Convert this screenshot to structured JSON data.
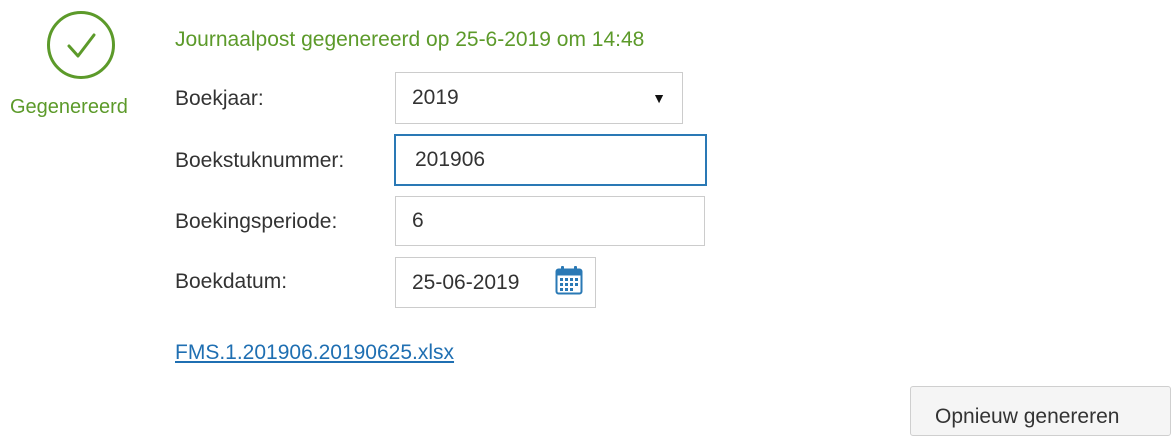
{
  "status": {
    "icon": "check-circle-icon",
    "label": "Gegenereerd",
    "color": "#5c9a2a",
    "headline": "Journaalpost gegenereerd op 25-6-2019 om 14:48"
  },
  "form": {
    "boekjaar": {
      "label": "Boekjaar:",
      "value": "2019",
      "icon": "caret-down-icon"
    },
    "boekstuknummer": {
      "label": "Boekstuknummer:",
      "value": "201906"
    },
    "boekingsperiode": {
      "label": "Boekingsperiode:",
      "value": "6"
    },
    "boekdatum": {
      "label": "Boekdatum:",
      "value": "25-06-2019",
      "icon": "calendar-icon"
    }
  },
  "file_link": "FMS.1.201906.20190625.xlsx",
  "buttons": {
    "regenerate": "Opnieuw genereren"
  },
  "colors": {
    "focus_border": "#2a79b5",
    "link": "#1f6fb2"
  }
}
